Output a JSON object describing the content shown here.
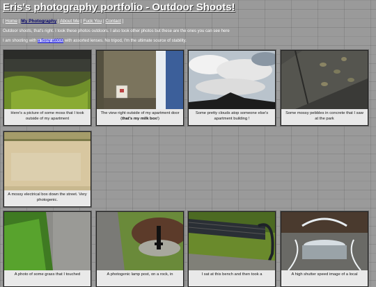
{
  "header": {
    "title": "Eris's photography portfolio - Outdoor Shoots!"
  },
  "nav": {
    "open": "[",
    "close": "]",
    "sep": "|",
    "items": [
      {
        "label": "Home"
      },
      {
        "label": "My Photography"
      },
      {
        "label": "About Me"
      },
      {
        "label": "Fuck You"
      },
      {
        "label": "Contact"
      }
    ]
  },
  "intro": {
    "text": "Outdoor shoots, that's right. I took these photos outdoors. I also took other photos but these are the ones you can see here"
  },
  "shooting": {
    "prefix": "I am shooting with",
    "camera_link": "a Sony a6000",
    "suffix": "with assorted lenses. No tripod, I'm the ultimate source of stability."
  },
  "gallery": [
    {
      "caption": "Here's a picture of some moss that I took outside of my apartment",
      "icon": "moss-photo"
    },
    {
      "caption_pre": "The view right outside of my apartment door (",
      "caption_bold": "that's my milk box",
      "caption_post": "!)",
      "icon": "doorway-photo"
    },
    {
      "caption": "Some pretty clouds atop someone else's apartment building !",
      "icon": "clouds-photo"
    },
    {
      "caption": "Some mossy pebbles in concrete that I saw at the park",
      "icon": "pebbles-photo"
    },
    {
      "caption": "A mossy electrical box down the street. Very photogenic.",
      "icon": "electrical-box-photo"
    },
    {
      "caption": "A photo of some grass that I touched",
      "icon": "grass-photo"
    },
    {
      "caption": "A photogenic lamp post, on a rock, in",
      "icon": "lamp-post-photo"
    },
    {
      "caption": "I sat at this bench and then took a",
      "icon": "bench-photo"
    },
    {
      "caption": "A high shutter speed image of a local",
      "icon": "fountain-photo"
    }
  ],
  "colors": {
    "background": "#9a9a9a",
    "card_bg": "#e9e9e9",
    "current_nav": "#000066",
    "camera_link": "#0000cc"
  }
}
